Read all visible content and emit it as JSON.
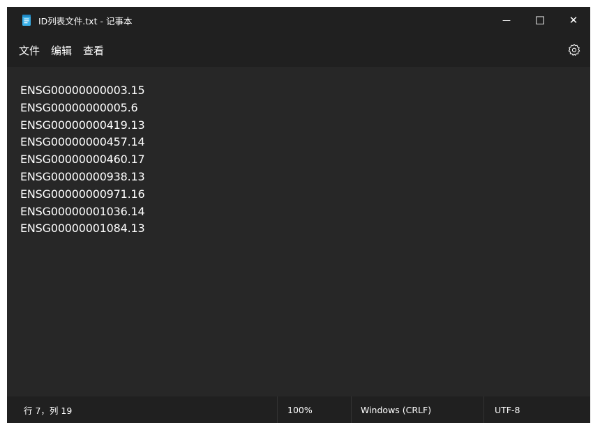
{
  "window": {
    "title": "ID列表文件.txt - 记事本",
    "controls": {
      "minimize": "—",
      "maximize": "☐",
      "close": "✕"
    }
  },
  "menu": {
    "items": [
      "文件",
      "编辑",
      "查看"
    ],
    "settings_icon": "gear-icon"
  },
  "editor": {
    "lines": [
      "ENSG00000000003.15",
      "ENSG00000000005.6",
      "ENSG00000000419.13",
      "ENSG00000000457.14",
      "ENSG00000000460.17",
      "ENSG00000000938.13",
      "ENSG00000000971.16",
      "ENSG00000001036.14",
      "ENSG00000001084.13"
    ]
  },
  "status": {
    "position": "行 7，列 19",
    "zoom": "100%",
    "line_ending": "Windows (CRLF)",
    "encoding": "UTF-8"
  },
  "colors": {
    "background": "#272727",
    "chrome": "#202020",
    "text": "#ffffff",
    "app_icon": "#3ab0e8"
  }
}
